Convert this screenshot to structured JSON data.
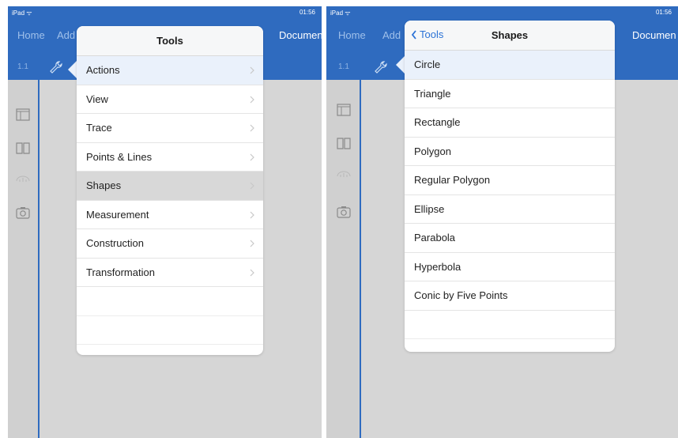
{
  "status": {
    "carrier": "iPad ᯤ",
    "time": "01:56"
  },
  "nav": {
    "home_label": "Home",
    "add_label": "Add",
    "document_label": "Documen"
  },
  "pagebar": {
    "page_number": "1.1"
  },
  "left_popover": {
    "title": "Tools",
    "items": [
      {
        "label": "Actions"
      },
      {
        "label": "View"
      },
      {
        "label": "Trace"
      },
      {
        "label": "Points & Lines"
      },
      {
        "label": "Shapes"
      },
      {
        "label": "Measurement"
      },
      {
        "label": "Construction"
      },
      {
        "label": "Transformation"
      }
    ],
    "selected_item": "Shapes"
  },
  "right_popover": {
    "back_label": "Tools",
    "title": "Shapes",
    "items": [
      {
        "label": "Circle"
      },
      {
        "label": "Triangle"
      },
      {
        "label": "Rectangle"
      },
      {
        "label": "Polygon"
      },
      {
        "label": "Regular Polygon"
      },
      {
        "label": "Ellipse"
      },
      {
        "label": "Parabola"
      },
      {
        "label": "Hyperbola"
      },
      {
        "label": "Conic by Five Points"
      }
    ]
  },
  "icons": [
    "wifi-icon",
    "wrench-icon",
    "page-layout-icon",
    "book-icon",
    "ruler-icon",
    "camera-icon",
    "chevron-right-icon",
    "chevron-left-icon"
  ],
  "colors": {
    "bar_blue": "#2f6bbf",
    "accent_blue": "#2b72d6",
    "highlight": "#eaf1fb",
    "selected_row": "#d8d8d8"
  }
}
